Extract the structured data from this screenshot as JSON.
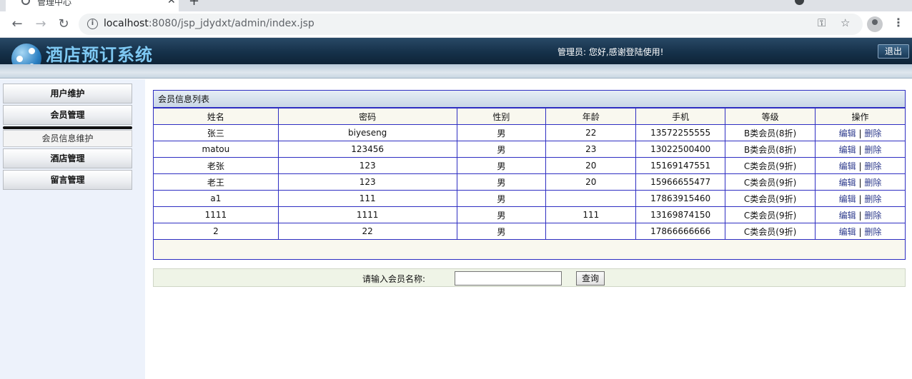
{
  "browser": {
    "tab_title": "管理中心",
    "tab_close": "✕",
    "new_tab": "+",
    "url_host": "localhost",
    "url_path": ":8080/jsp_jdydxt/admin/index.jsp"
  },
  "header": {
    "title": "酒店预订系统",
    "welcome": "管理员:  您好,感谢登陆使用!",
    "logout_label": "退出"
  },
  "sidebar": {
    "items": [
      {
        "label": "用户维护"
      },
      {
        "label": "会员管理"
      },
      {
        "label": "会员信息维护"
      },
      {
        "label": "酒店管理"
      },
      {
        "label": "留言管理"
      }
    ]
  },
  "panel": {
    "title": "会员信息列表",
    "columns": [
      "姓名",
      "密码",
      "性别",
      "年龄",
      "手机",
      "等级",
      "操作"
    ],
    "rows": [
      {
        "name": "张三",
        "password": "biyeseng",
        "gender": "男",
        "age": "22",
        "phone": "13572255555",
        "level": "B类会员(8折)"
      },
      {
        "name": "matou",
        "password": "123456",
        "gender": "男",
        "age": "23",
        "phone": "13022500400",
        "level": "B类会员(8折)"
      },
      {
        "name": "老张",
        "password": "123",
        "gender": "男",
        "age": "20",
        "phone": "15169147551",
        "level": "C类会员(9折)"
      },
      {
        "name": "老王",
        "password": "123",
        "gender": "男",
        "age": "20",
        "phone": "15966655477",
        "level": "C类会员(9折)"
      },
      {
        "name": "a1",
        "password": "111",
        "gender": "男",
        "age": "",
        "phone": "17863915460",
        "level": "C类会员(9折)"
      },
      {
        "name": "1111",
        "password": "1111",
        "gender": "男",
        "age": "111",
        "phone": "13169874150",
        "level": "C类会员(9折)"
      },
      {
        "name": "2",
        "password": "22",
        "gender": "男",
        "age": "",
        "phone": "17866666666",
        "level": "C类会员(9折)"
      }
    ],
    "edit_label": "编辑",
    "separator": "|",
    "delete_label": "删除"
  },
  "search": {
    "label": "请输入会员名称:",
    "value": "",
    "button_label": "查询"
  },
  "colors": {
    "header_dark": "#15314a",
    "title_blue": "#7ec8f2",
    "table_border": "#2e2ec2",
    "sidebar_bg": "#edf2fb"
  }
}
